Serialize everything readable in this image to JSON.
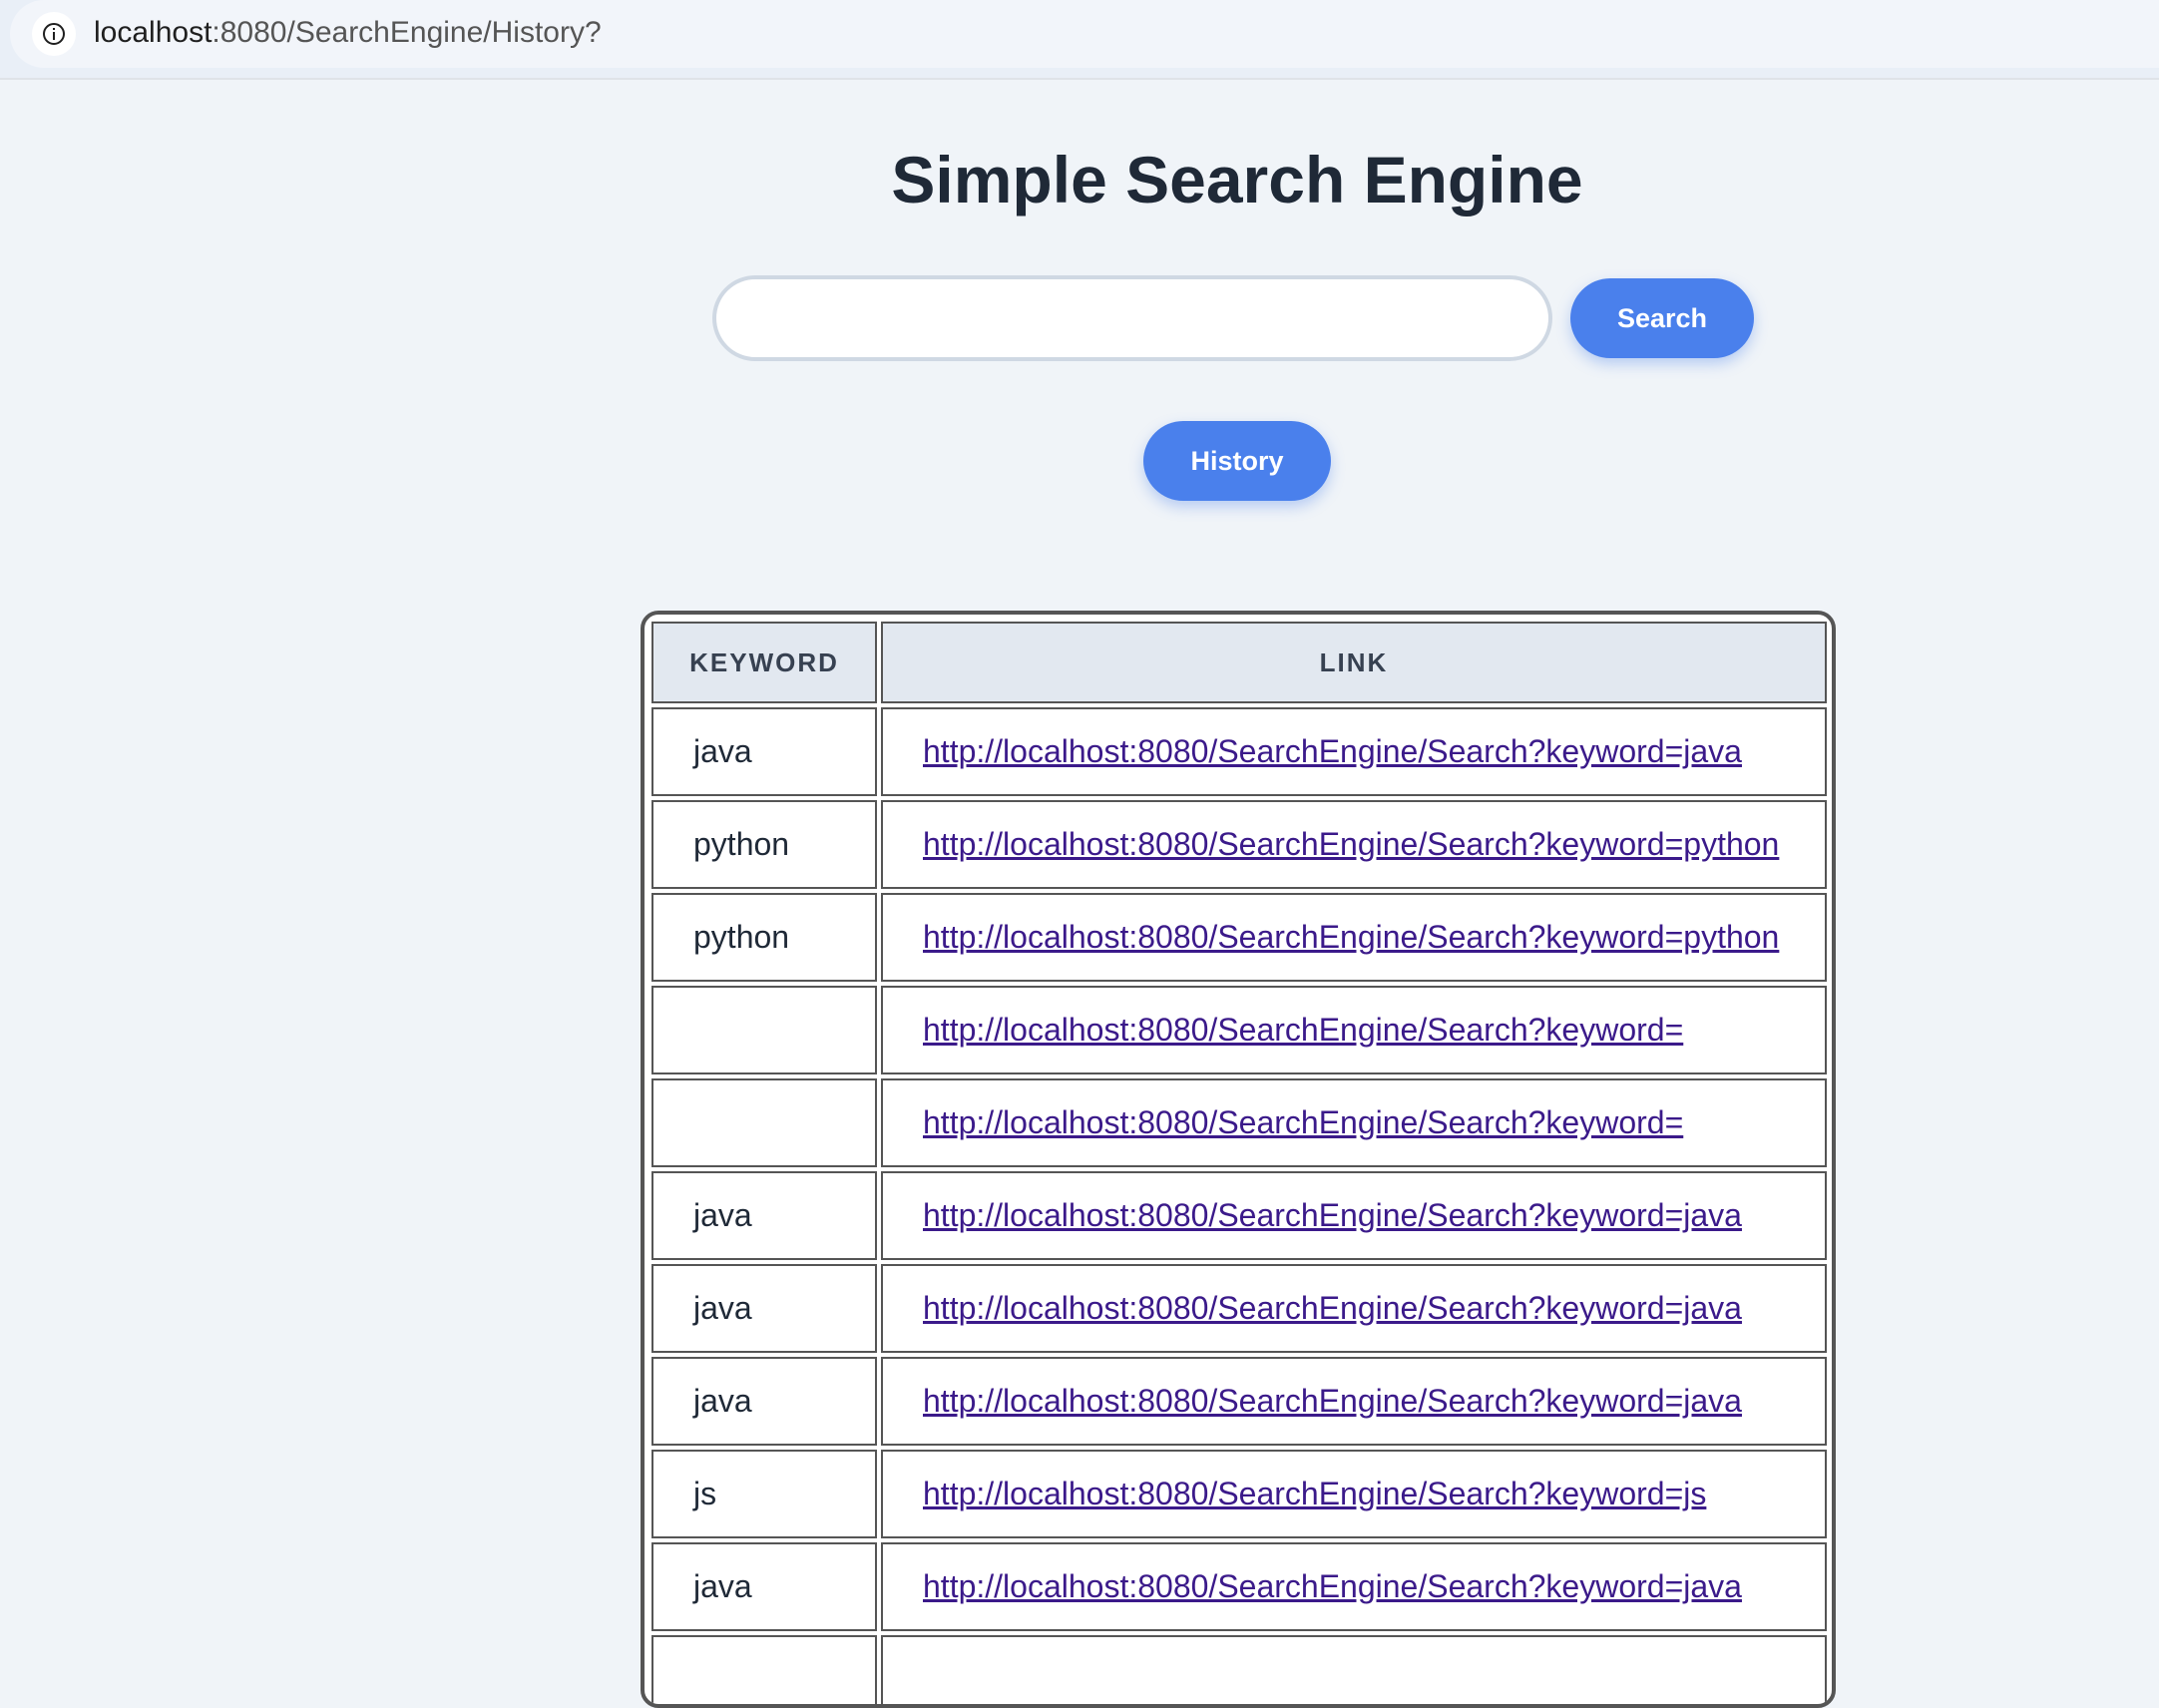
{
  "browser": {
    "url_host": "localhost",
    "url_rest": ":8080/SearchEngine/History?"
  },
  "header": {
    "title": "Simple Search Engine"
  },
  "search": {
    "value": "",
    "placeholder": "",
    "button_label": "Search"
  },
  "history_button_label": "History",
  "table": {
    "columns": [
      "KEYWORD",
      "LINK"
    ],
    "rows": [
      {
        "keyword": "java",
        "link": "http://localhost:8080/SearchEngine/Search?keyword=java"
      },
      {
        "keyword": "python",
        "link": "http://localhost:8080/SearchEngine/Search?keyword=python"
      },
      {
        "keyword": "python",
        "link": "http://localhost:8080/SearchEngine/Search?keyword=python"
      },
      {
        "keyword": "",
        "link": "http://localhost:8080/SearchEngine/Search?keyword="
      },
      {
        "keyword": "",
        "link": "http://localhost:8080/SearchEngine/Search?keyword="
      },
      {
        "keyword": "java",
        "link": "http://localhost:8080/SearchEngine/Search?keyword=java"
      },
      {
        "keyword": "java",
        "link": "http://localhost:8080/SearchEngine/Search?keyword=java"
      },
      {
        "keyword": "java",
        "link": "http://localhost:8080/SearchEngine/Search?keyword=java"
      },
      {
        "keyword": "js",
        "link": "http://localhost:8080/SearchEngine/Search?keyword=js"
      },
      {
        "keyword": "java",
        "link": "http://localhost:8080/SearchEngine/Search?keyword=java"
      },
      {
        "keyword": "",
        "link": ""
      }
    ]
  },
  "colors": {
    "accent": "#4a80ec",
    "link": "#3b1a8a",
    "background": "#f0f4f8"
  }
}
